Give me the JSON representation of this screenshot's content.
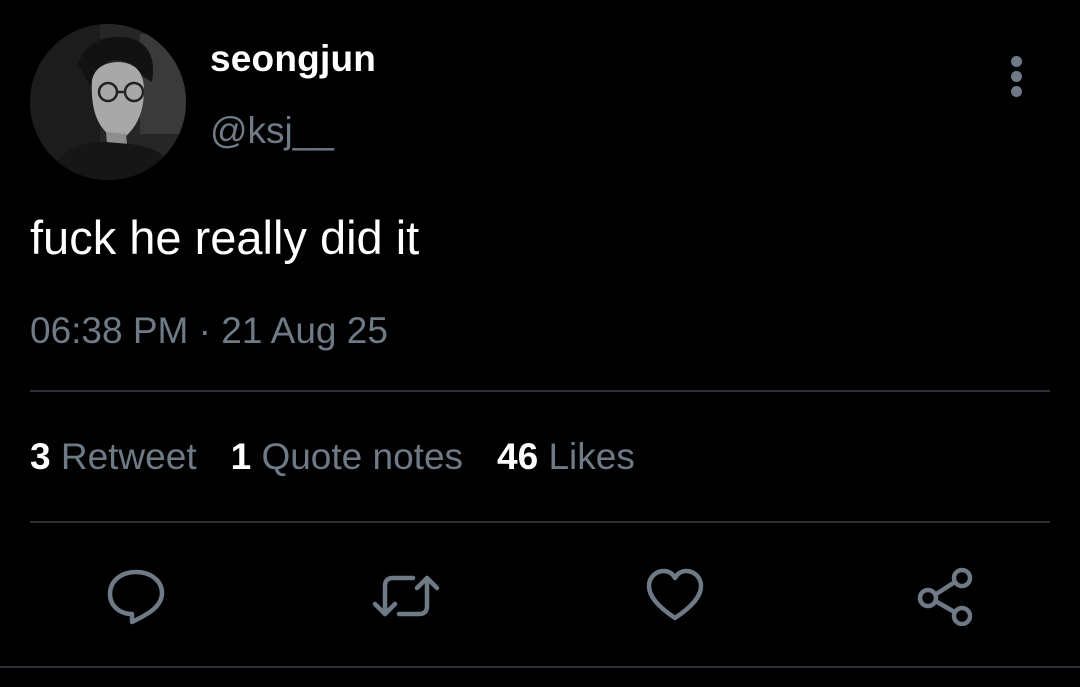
{
  "tweet": {
    "display_name": "seongjun",
    "handle": "@ksj__",
    "text": "fuck he really did it",
    "timestamp": "06:38 PM · 21 Aug 25",
    "stats": {
      "retweets_count": "3",
      "retweets_label": "Retweet",
      "quotes_count": "1",
      "quotes_label": "Quote notes",
      "likes_count": "46",
      "likes_label": "Likes"
    }
  },
  "icons": {
    "more": "more-vertical-icon",
    "reply": "reply-icon",
    "retweet": "retweet-icon",
    "like": "heart-icon",
    "share": "share-icon"
  },
  "colors": {
    "background": "#000000",
    "primary_text": "#ffffff",
    "secondary_text": "#6e7a86",
    "divider": "#2b3036"
  }
}
